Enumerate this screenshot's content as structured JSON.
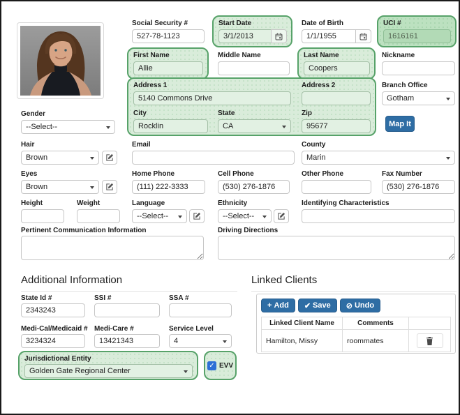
{
  "colors": {
    "accent_blue": "#2e6da4",
    "highlight_green_border": "#57a269",
    "highlight_green_fill": "#d9ecda",
    "checkbox_blue": "#2d6fd6"
  },
  "identity": {
    "ssn": {
      "label": "Social Security #",
      "value": "527-78-1123"
    },
    "start_date": {
      "label": "Start Date",
      "value": "3/1/2013"
    },
    "dob": {
      "label": "Date of Birth",
      "value": "1/1/1955"
    },
    "uci": {
      "label": "UCI #",
      "value": "1616161"
    },
    "first_name": {
      "label": "First Name",
      "value": "Allie"
    },
    "middle_name": {
      "label": "Middle Name",
      "value": ""
    },
    "last_name": {
      "label": "Last Name",
      "value": "Coopers"
    },
    "nickname": {
      "label": "Nickname",
      "value": ""
    }
  },
  "address": {
    "address1": {
      "label": "Address 1",
      "value": "5140 Commons Drive"
    },
    "address2": {
      "label": "Address 2",
      "value": ""
    },
    "city": {
      "label": "City",
      "value": "Rocklin"
    },
    "state": {
      "label": "State",
      "value": "CA"
    },
    "zip": {
      "label": "Zip",
      "value": "95677"
    },
    "branch_office": {
      "label": "Branch Office",
      "value": "Gotham"
    },
    "map_button": "Map It"
  },
  "personal": {
    "gender": {
      "label": "Gender",
      "value": "--Select--"
    },
    "hair": {
      "label": "Hair",
      "value": "Brown"
    },
    "eyes": {
      "label": "Eyes",
      "value": "Brown"
    },
    "height": {
      "label": "Height",
      "value": ""
    },
    "weight": {
      "label": "Weight",
      "value": ""
    },
    "language": {
      "label": "Language",
      "value": "--Select--"
    },
    "ethnicity": {
      "label": "Ethnicity",
      "value": "--Select--"
    },
    "identifying": {
      "label": "Identifying Characteristics",
      "value": ""
    }
  },
  "contact": {
    "email": {
      "label": "Email",
      "value": ""
    },
    "county": {
      "label": "County",
      "value": "Marin"
    },
    "home_phone": {
      "label": "Home Phone",
      "value": "(111) 222-3333"
    },
    "cell_phone": {
      "label": "Cell Phone",
      "value": "(530) 276-1876"
    },
    "other_phone": {
      "label": "Other Phone",
      "value": ""
    },
    "fax": {
      "label": "Fax Number",
      "value": "(530) 276-1876"
    }
  },
  "notes": {
    "pertinent": {
      "label": "Pertinent Communication Information",
      "value": ""
    },
    "driving": {
      "label": "Driving Directions",
      "value": ""
    }
  },
  "additional": {
    "heading": "Additional Information",
    "state_id": {
      "label": "State Id #",
      "value": "2343243"
    },
    "ssi": {
      "label": "SSI #",
      "value": ""
    },
    "ssa": {
      "label": "SSA #",
      "value": ""
    },
    "medi_cal": {
      "label": "Medi-Cal/Medicaid #",
      "value": "3234324"
    },
    "medi_care": {
      "label": "Medi-Care #",
      "value": "13421343"
    },
    "service_level": {
      "label": "Service Level",
      "value": "4"
    },
    "jurisdictional": {
      "label": "Jurisdictional Entity",
      "value": "Golden Gate Regional Center"
    },
    "evv": {
      "label": "EVV",
      "checked": true
    }
  },
  "linked_clients": {
    "heading": "Linked Clients",
    "buttons": {
      "add": {
        "icon": "+",
        "label": "Add"
      },
      "save": {
        "icon": "✔",
        "label": "Save"
      },
      "undo": {
        "icon": "⊘",
        "label": "Undo"
      }
    },
    "columns": {
      "name": "Linked Client Name",
      "comments": "Comments",
      "actions": ""
    },
    "rows": [
      {
        "name": "Hamilton, Missy",
        "comments": "roommates"
      }
    ]
  }
}
